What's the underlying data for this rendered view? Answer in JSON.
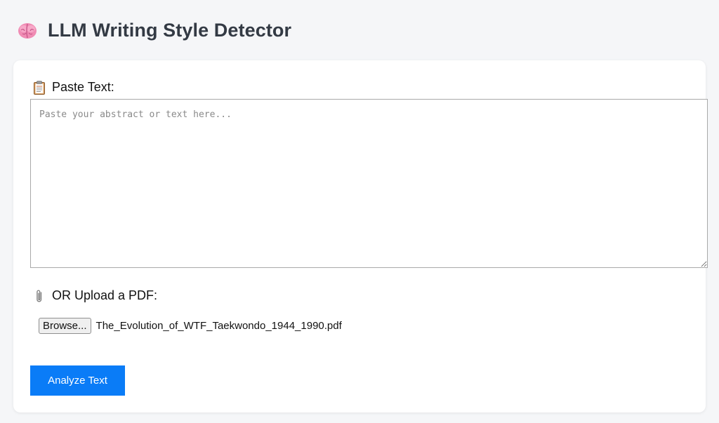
{
  "header": {
    "title": "LLM Writing Style Detector",
    "icon": "brain-icon"
  },
  "form": {
    "paste_label": "Paste Text:",
    "paste_icon": "clipboard-icon",
    "textarea_placeholder": "Paste your abstract or text here...",
    "textarea_value": "",
    "upload_label": "OR Upload a PDF:",
    "upload_icon": "paperclip-icon",
    "browse_label": "Browse...",
    "selected_file": "The_Evolution_of_WTF_Taekwondo_1944_1990.pdf",
    "analyze_label": "Analyze Text"
  },
  "colors": {
    "page_background": "#f5f6f8",
    "card_background": "#ffffff",
    "accent": "#0a7cf7",
    "title_text": "#333a44"
  }
}
